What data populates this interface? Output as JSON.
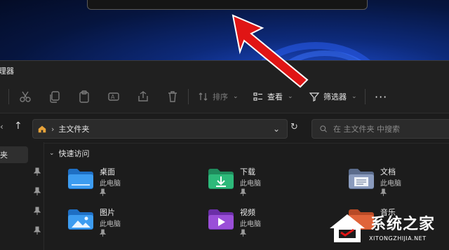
{
  "window": {
    "title_partial": "理器"
  },
  "toolbar": {
    "sort_label": "排序",
    "view_label": "查看",
    "filter_label": "筛选器"
  },
  "address": {
    "path": "主文件夹",
    "search_placeholder": "在 主文件夹 中搜索"
  },
  "sidebar": {
    "selected_partial": "夹"
  },
  "quick_access": {
    "header": "快速访问",
    "items": [
      {
        "name": "桌面",
        "location": "此电脑",
        "color": "#2f8be6"
      },
      {
        "name": "下载",
        "location": "此电脑",
        "color": "#2db97a"
      },
      {
        "name": "文档",
        "location": "此电脑",
        "color": "#7c8fb3"
      },
      {
        "name": "图片",
        "location": "此电脑",
        "color": "#2f8be6"
      },
      {
        "name": "视频",
        "location": "此电脑",
        "color": "#9a4fd8"
      },
      {
        "name": "音乐",
        "location": "",
        "color": "#e0643a"
      }
    ]
  },
  "watermark": {
    "title": "系统之家",
    "url": "XITONGZHIJIA.NET"
  }
}
